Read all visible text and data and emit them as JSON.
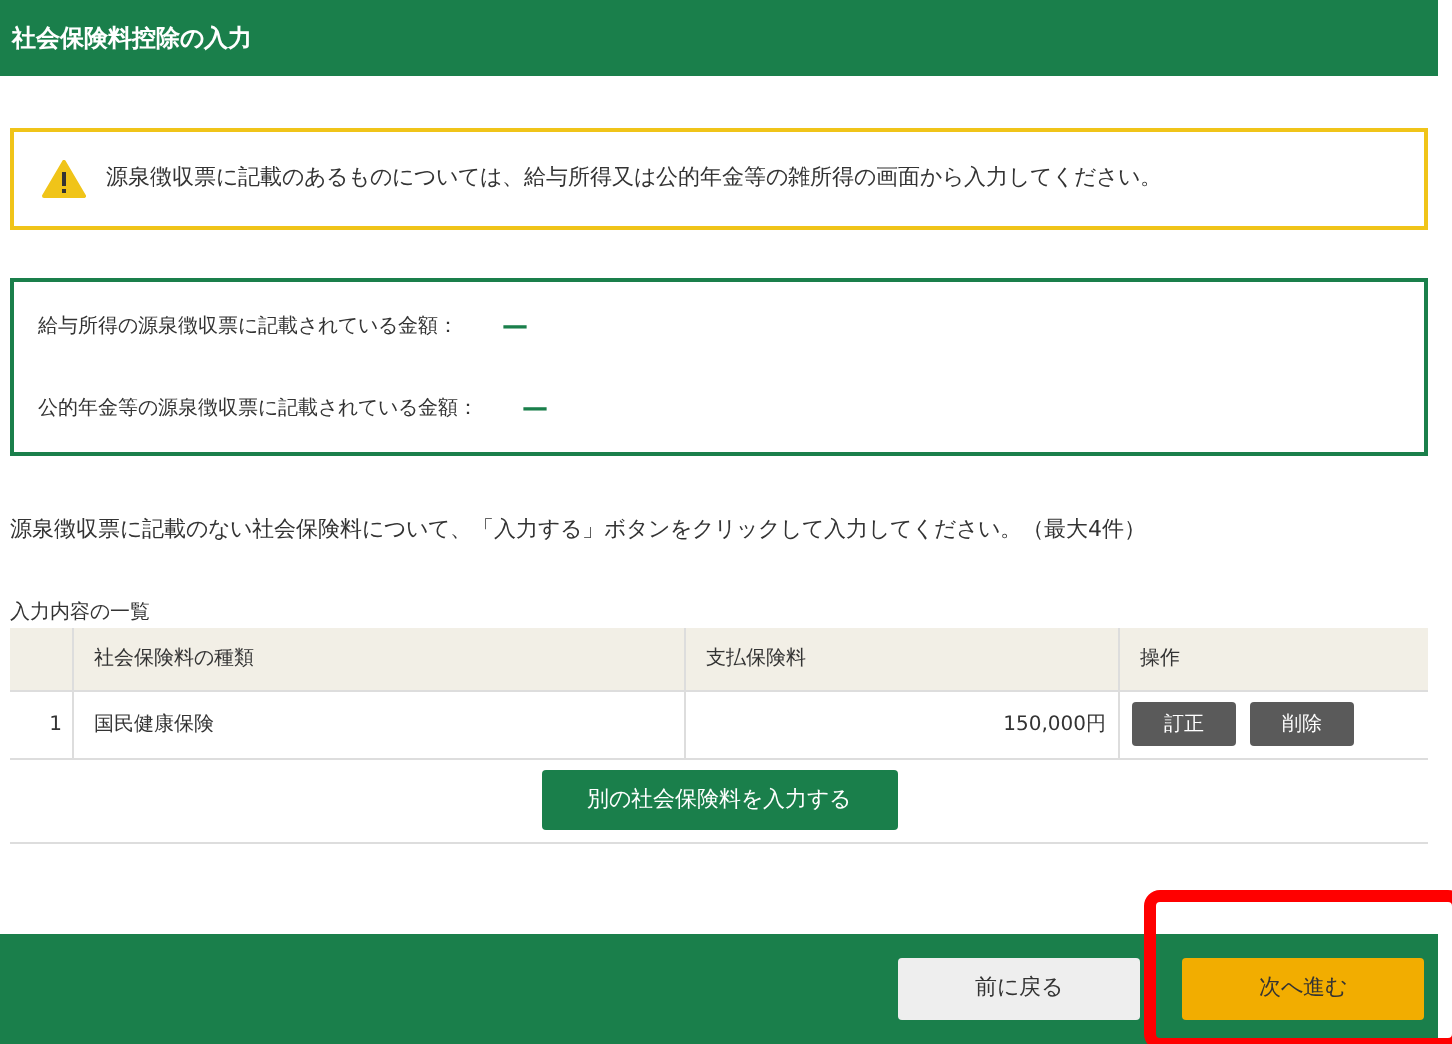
{
  "header": {
    "title": "社会保険料控除の入力"
  },
  "warning": {
    "text": "源泉徴収票に記載のあるものについては、給与所得又は公的年金等の雑所得の画面から入力してください。"
  },
  "summary": [
    {
      "label": "給与所得の源泉徴収票に記載されている金額：",
      "value": "—"
    },
    {
      "label": "公的年金等の源泉徴収票に記載されている金額：",
      "value": "—"
    }
  ],
  "instruction": "源泉徴収票に記載のない社会保険料について、「入力する」ボタンをクリックして入力してください。（最大4件）",
  "table": {
    "caption": "入力内容の一覧",
    "columns": [
      "社会保険料の種類",
      "支払保険料",
      "操作"
    ],
    "rows": [
      {
        "number": "1",
        "type": "国民健康保険",
        "amount": "150,000円",
        "actions": [
          "訂正",
          "削除"
        ]
      }
    ],
    "add_button": "別の社会保険料を入力する"
  },
  "footer": {
    "buttons": [
      {
        "label": "前に戻る",
        "kind": "secondary"
      },
      {
        "label": "次へ進む",
        "kind": "primary",
        "highlighted": true
      }
    ]
  }
}
